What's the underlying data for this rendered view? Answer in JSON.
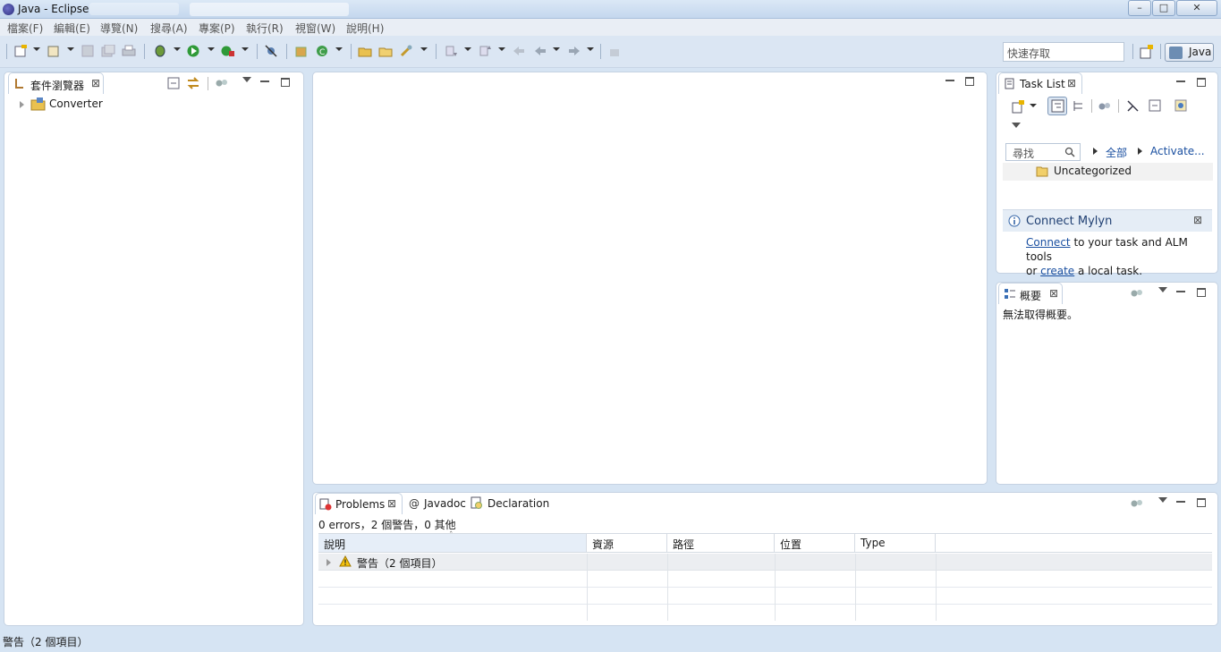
{
  "window": {
    "title": "Java - Eclipse",
    "controls": {
      "minimize": "–",
      "maximize": "□",
      "close": "✕"
    }
  },
  "menu": [
    "檔案(F)",
    "編輯(E)",
    "導覽(N)",
    "搜尋(A)",
    "專案(P)",
    "執行(R)",
    "視窗(W)",
    "說明(H)"
  ],
  "toolbar": {
    "quick_access_placeholder": "快速存取",
    "perspective_label": "Java"
  },
  "package_explorer": {
    "tab_label": "套件瀏覽器",
    "items": [
      {
        "label": "Converter"
      }
    ]
  },
  "task_list": {
    "tab_label": "Task List",
    "search_placeholder": "尋找",
    "filter_all": "全部",
    "activate": "Activate...",
    "category": "Uncategorized"
  },
  "mylyn": {
    "title": "Connect Mylyn",
    "connect_link": "Connect",
    "text1": " to your task and ALM tools",
    "or_text": "or ",
    "create_link": "create",
    "text2": " a local task."
  },
  "outline": {
    "tab_label": "概要",
    "message": "無法取得概要。"
  },
  "problems": {
    "tabs": [
      "Problems",
      "Javadoc",
      "Declaration"
    ],
    "tab_at_symbol": "@",
    "summary": "0 errors，2 個警告，0 其他",
    "columns": [
      "說明",
      "資源",
      "路徑",
      "位置",
      "Type"
    ],
    "rows": [
      {
        "label": "警告（2 個項目）"
      }
    ]
  },
  "status_bar": {
    "text": "警告（2 個項目）"
  },
  "colors": {
    "accent": "#1a4fa0",
    "background": "#d6e4f3",
    "warning": "#e5a800"
  }
}
